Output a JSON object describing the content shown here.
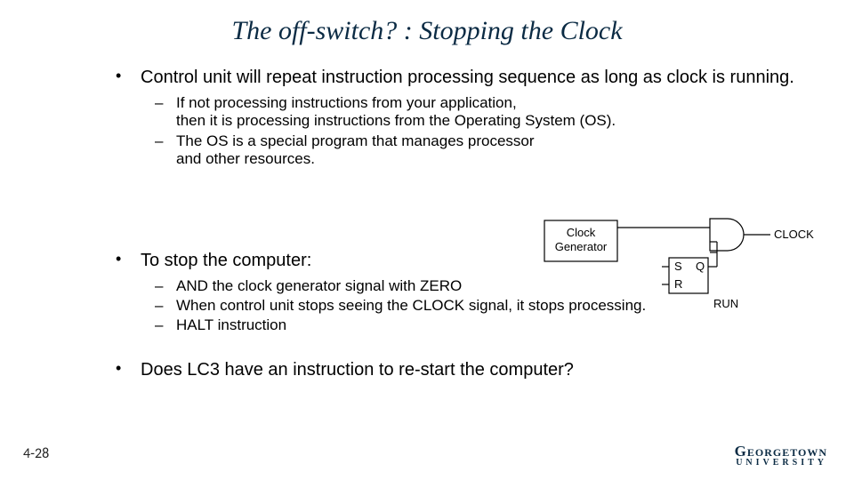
{
  "title": "The off-switch? :  Stopping the Clock",
  "bullets": {
    "b1": {
      "text": "Control unit will repeat instruction processing sequence as long as clock is running.",
      "subs": {
        "s1": "If not processing instructions from your application,\nthen it is processing instructions from the Operating System (OS).",
        "s2": "The OS is a special program that manages processor\nand other resources."
      }
    },
    "b2": {
      "text": "To stop the computer:",
      "subs": {
        "s1": "AND the clock generator signal with ZERO",
        "s2": "When control unit stops seeing the CLOCK signal, it stops processing.",
        "s3": "HALT instruction"
      }
    },
    "b3": {
      "text": "Does LC3 have an instruction to re-start the computer?"
    }
  },
  "diagram": {
    "clock_gen_line1": "Clock",
    "clock_gen_line2": "Generator",
    "latch_s": "S",
    "latch_r": "R",
    "latch_q": "Q",
    "out_clock": "CLOCK",
    "out_run": "RUN"
  },
  "slide_number": "4-28",
  "logo": {
    "name": "Georgetown",
    "univ": "UNIVERSITY"
  }
}
